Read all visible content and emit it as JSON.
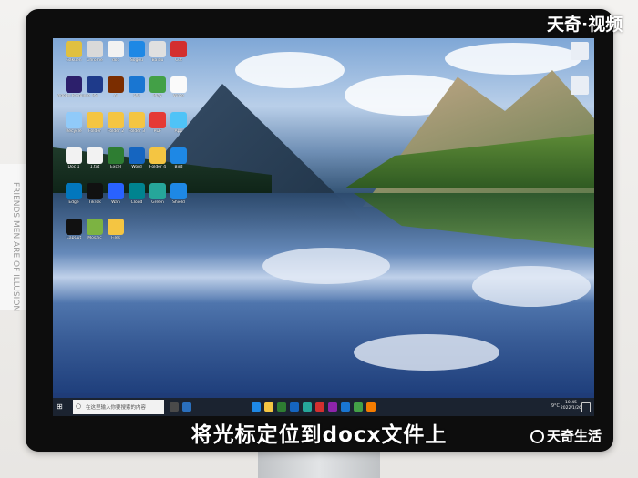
{
  "watermarks": {
    "top": "天奇·视频",
    "bottom": "天奇生活"
  },
  "subtitle": "将光标定位到docx文件上",
  "side_paper_text": "FRIENDS MEN ARE OF ILLUSION",
  "desktop": {
    "icons": [
      {
        "label": "Gakuen",
        "color": "#e0c040"
      },
      {
        "label": "Chrome",
        "color": "#d9d9d9"
      },
      {
        "label": "doc",
        "color": "#f2f2f2"
      },
      {
        "label": "Sogou",
        "color": "#1e88e5"
      },
      {
        "label": "Baidu",
        "color": "#e0e0e0"
      },
      {
        "label": "Cut",
        "color": "#d32f2f"
      },
      {
        "label": "Adobe Premiere",
        "color": "#2c1f6b"
      },
      {
        "label": "PS",
        "color": "#1e3a8a"
      },
      {
        "label": "Ai",
        "color": "#7b2d00"
      },
      {
        "label": "QQ",
        "color": "#1976d2"
      },
      {
        "label": "Play",
        "color": "#43a047"
      },
      {
        "label": "Write",
        "color": "#fafafa"
      },
      {
        "label": "Recycle",
        "color": "#90caf9"
      },
      {
        "label": "Folder",
        "color": "#f4c542"
      },
      {
        "label": "Folder 2",
        "color": "#f4c542"
      },
      {
        "label": "Folder 3",
        "color": "#f4c542"
      },
      {
        "label": "PDF",
        "color": "#e53935"
      },
      {
        "label": "App",
        "color": "#4fc3f7"
      },
      {
        "label": "Doc 1",
        "color": "#f2f2f2"
      },
      {
        "label": "1.txt",
        "color": "#f2f2f2"
      },
      {
        "label": "Excel",
        "color": "#2e7d32"
      },
      {
        "label": "Word",
        "color": "#1565c0"
      },
      {
        "label": "Folder 4",
        "color": "#f4c542"
      },
      {
        "label": "Bird",
        "color": "#1e88e5"
      },
      {
        "label": "Edge",
        "color": "#0277bd"
      },
      {
        "label": "TikTok",
        "color": "#111111"
      },
      {
        "label": "Wan",
        "color": "#2962ff"
      },
      {
        "label": "Cloud",
        "color": "#00838f"
      },
      {
        "label": "Green",
        "color": "#26a69a"
      },
      {
        "label": "Shield",
        "color": "#1e88e5"
      },
      {
        "label": "CapCut",
        "color": "#111111"
      },
      {
        "label": "Mosaic",
        "color": "#7cb342"
      },
      {
        "label": "Files",
        "color": "#f4c542"
      }
    ]
  },
  "taskbar": {
    "start_icon": "⊞",
    "search_placeholder": "在这里输入你要搜索的内容",
    "search_icon": "○",
    "tray": "9°C",
    "time": "10:45",
    "date": "2022/1/26"
  }
}
